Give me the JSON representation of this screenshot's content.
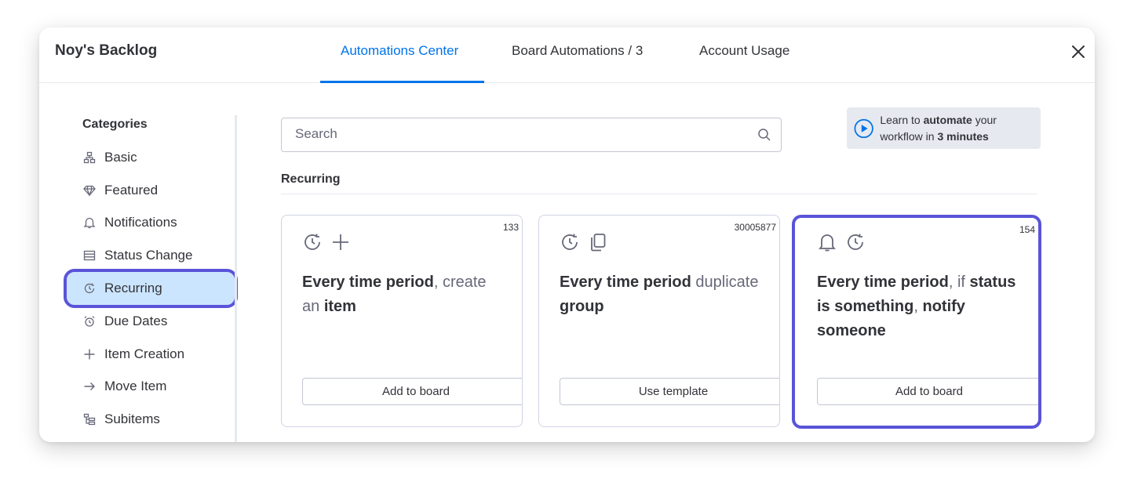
{
  "header": {
    "board_title": "Noy's Backlog",
    "tabs": [
      {
        "label": "Automations Center",
        "active": true
      },
      {
        "label": "Board Automations / 3",
        "active": false
      },
      {
        "label": "Account Usage",
        "active": false
      }
    ],
    "close_icon": "close-icon"
  },
  "sidebar": {
    "title": "Categories",
    "items": [
      {
        "label": "Basic",
        "icon": "basic-icon"
      },
      {
        "label": "Featured",
        "icon": "diamond-icon"
      },
      {
        "label": "Notifications",
        "icon": "bell-icon"
      },
      {
        "label": "Status Change",
        "icon": "status-icon"
      },
      {
        "label": "Recurring",
        "icon": "recurring-icon",
        "selected": true
      },
      {
        "label": "Due Dates",
        "icon": "alarm-clock-icon"
      },
      {
        "label": "Item Creation",
        "icon": "plus-icon"
      },
      {
        "label": "Move Item",
        "icon": "arrow-right-icon"
      },
      {
        "label": "Subitems",
        "icon": "subitems-icon"
      }
    ]
  },
  "search": {
    "placeholder": "Search",
    "value": ""
  },
  "learn": {
    "pre": "Learn to ",
    "bold1": "automate",
    "mid": " your workflow in ",
    "bold2": "3 minutes"
  },
  "section": {
    "title": "Recurring"
  },
  "cards": [
    {
      "count": "133",
      "icons": [
        "recurring-icon",
        "plus-icon"
      ],
      "parts": [
        {
          "t": "Every time period",
          "b": true
        },
        {
          "t": ", create",
          "b": false
        },
        {
          "t": " an ",
          "b": false
        },
        {
          "t": "item",
          "b": true
        }
      ],
      "button": "Add to board"
    },
    {
      "count": "30005877",
      "icons": [
        "recurring-icon",
        "duplicate-icon"
      ],
      "parts": [
        {
          "t": "Every time period",
          "b": true
        },
        {
          "t": " duplicate",
          "b": false
        },
        {
          "t": " group",
          "b": true
        }
      ],
      "button": "Use template"
    },
    {
      "count": "154",
      "icons": [
        "bell-icon",
        "recurring-icon"
      ],
      "parts": [
        {
          "t": "Every time period",
          "b": true
        },
        {
          "t": ", if ",
          "b": false
        },
        {
          "t": "status is something",
          "b": true
        },
        {
          "t": ", ",
          "b": false
        },
        {
          "t": "notify someone",
          "b": true
        }
      ],
      "button": "Add to board"
    }
  ],
  "colors": {
    "accent": "#0073ea",
    "highlight": "#5a54d8",
    "selected_bg": "#cce5ff",
    "text": "#323338",
    "muted": "#676879"
  }
}
